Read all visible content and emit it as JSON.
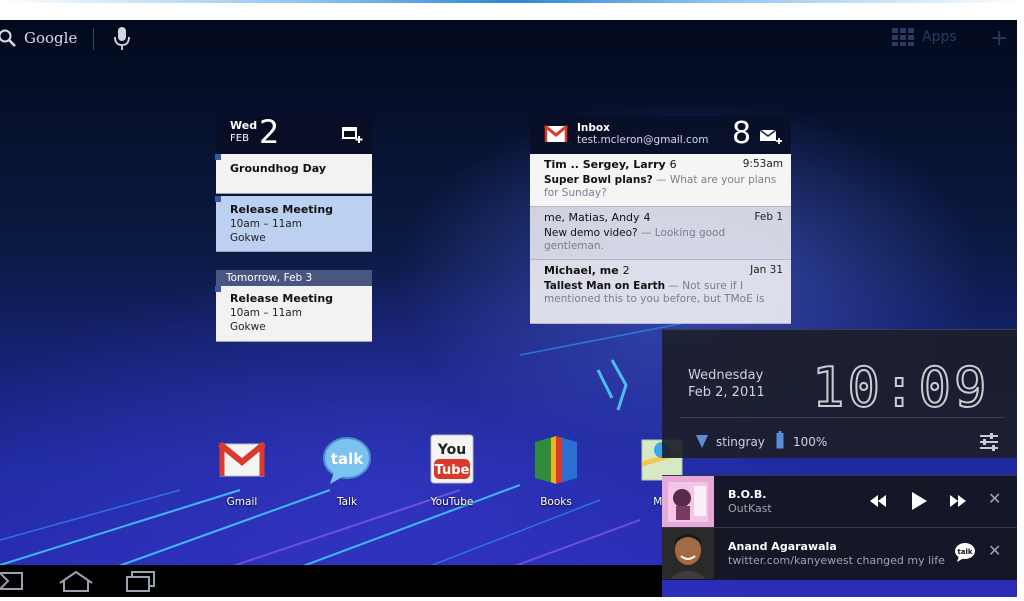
{
  "topbar": {
    "search_label": "Google",
    "apps_label": "Apps"
  },
  "calendar": {
    "day": "Wed",
    "month": "FEB",
    "date": "2",
    "events": [
      {
        "title": "Groundhog Day",
        "time": "",
        "location": ""
      },
      {
        "title": "Release Meeting",
        "time": "10am – 11am",
        "location": "Gokwe"
      },
      {
        "title": "Release Meeting",
        "time": "10am – 11am",
        "location": "Gokwe"
      }
    ],
    "divider": "Tomorrow, Feb 3"
  },
  "gmail": {
    "title": "Inbox",
    "account": "test.mcleron@gmail.com",
    "unread_count": "8",
    "messages": [
      {
        "from": "Tim .. Sergey, Larry",
        "count": "6",
        "date": "9:53am",
        "subject": "Super Bowl plans?",
        "snippet": " — What are your plans for Sunday?"
      },
      {
        "from": "me, Matias, Andy",
        "count": "4",
        "date": "Feb 1",
        "subject": "New demo video?",
        "snippet": " — Looking good gentleman."
      },
      {
        "from": "Michael, me",
        "count": "2",
        "date": "Jan 31",
        "subject": "Tallest Man on Earth",
        "snippet": " — Not sure if I mentioned this to you before, but TMoE is"
      }
    ]
  },
  "dock": [
    {
      "label": "Gmail",
      "icon": "gmail-icon"
    },
    {
      "label": "Talk",
      "icon": "talk-icon"
    },
    {
      "label": "YouTube",
      "icon": "youtube-icon"
    },
    {
      "label": "Books",
      "icon": "books-icon"
    },
    {
      "label": "Ma",
      "icon": "maps-icon"
    }
  ],
  "clock": {
    "day": "Wednesday",
    "date": "Feb 2, 2011",
    "time": "10:09",
    "network": "stingray",
    "battery": "100%"
  },
  "notifications": {
    "music": {
      "title": "B.O.B.",
      "artist": "OutKast"
    },
    "talk": {
      "name": "Anand Agarawala",
      "message": "twitter.com/kanyewest changed my life"
    }
  },
  "colors": {
    "wallpaper": "#1f2aa0",
    "accent": "#33b5e5",
    "gmail_red": "#d93a2b"
  }
}
